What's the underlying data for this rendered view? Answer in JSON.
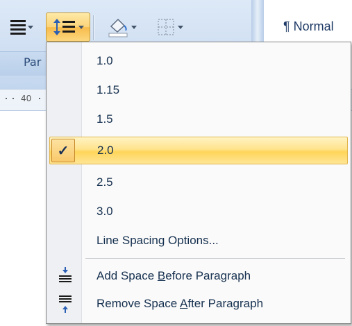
{
  "ribbon": {
    "group_label": "Par",
    "style_label": "¶ Normal"
  },
  "ruler": {
    "marker": "40"
  },
  "menu": {
    "items": [
      {
        "label": "1.0",
        "checked": false
      },
      {
        "label": "1.15",
        "checked": false
      },
      {
        "label": "1.5",
        "checked": false
      },
      {
        "label": "2.0",
        "checked": true
      },
      {
        "label": "2.5",
        "checked": false
      },
      {
        "label": "3.0",
        "checked": false
      }
    ],
    "checkmark": "✓",
    "options_label": "Line Spacing Options...",
    "add_space": {
      "before": "Add Space ",
      "key": "B",
      "after": "efore Paragraph",
      "icon": "add-space-before-icon"
    },
    "remove_space": {
      "before": "Remove Space ",
      "key": "A",
      "after": "fter Paragraph",
      "icon": "remove-space-after-icon"
    }
  }
}
